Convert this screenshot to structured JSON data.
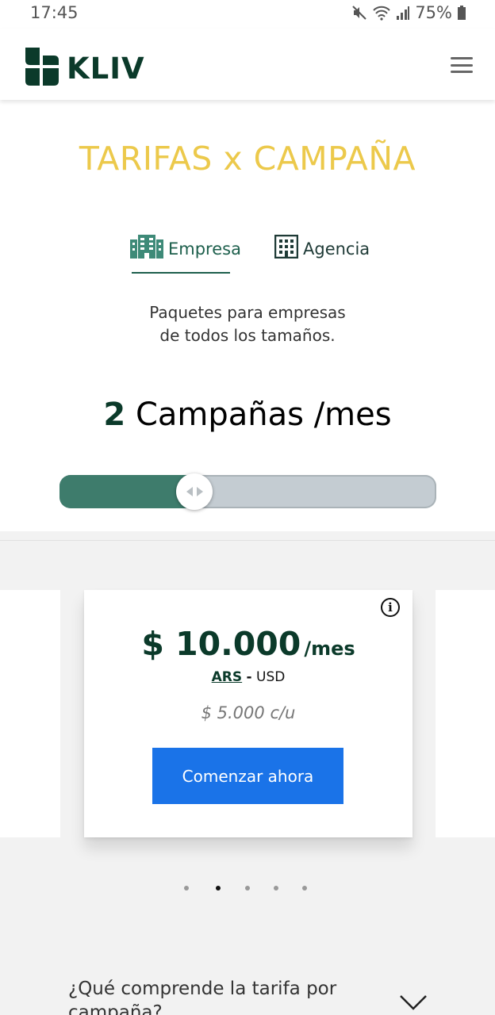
{
  "status_bar": {
    "time": "17:45",
    "battery": "75%"
  },
  "header": {
    "logo_text": "KLIV",
    "menu_icon": "hamburger-menu-icon"
  },
  "page": {
    "title": "TARIFAS x CAMPAÑA"
  },
  "tabs": [
    {
      "label": "Empresa",
      "icon": "building-icon",
      "active": true
    },
    {
      "label": "Agencia",
      "icon": "office-building-icon",
      "active": false
    }
  ],
  "subtitle": {
    "line1": "Paquetes para empresas",
    "line2": "de todos los tamaños."
  },
  "campaigns": {
    "count": "2",
    "label": "Campañas /mes"
  },
  "slider": {
    "value": 2,
    "min": 1,
    "max": 10
  },
  "pricing_card": {
    "price": "$ 10.000",
    "period": "/mes",
    "currency_selected": "ARS",
    "currency_separator": "-",
    "currency_other": "USD",
    "unit_price": "$ 5.000 c/u",
    "cta_label": "Comenzar ahora",
    "info_icon": "info-icon"
  },
  "carousel": {
    "count": 5,
    "active_index": 1
  },
  "faq": {
    "question": "¿Qué comprende la tarifa por campaña?"
  },
  "colors": {
    "brand_dark": "#0b3a2a",
    "brand_green": "#1d5f4c",
    "title_yellow": "#ecc94b",
    "slider_fill": "#3e7c6c",
    "cta_blue": "#1a73e8"
  }
}
